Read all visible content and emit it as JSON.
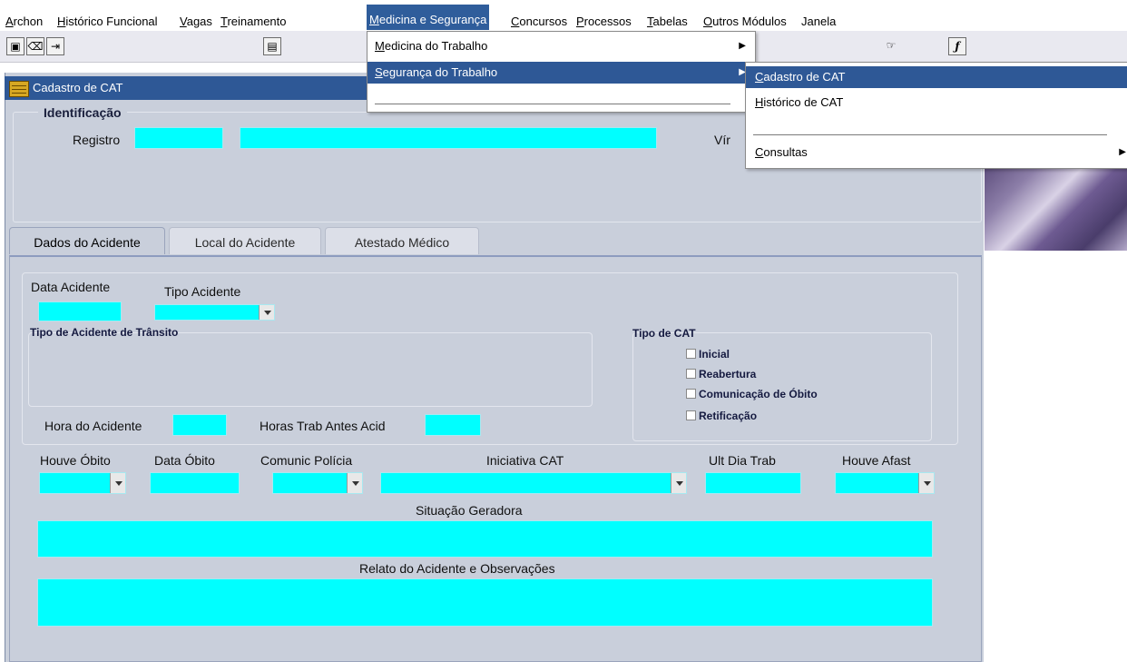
{
  "menubar": {
    "items": [
      {
        "pre": "",
        "u": "A",
        "post": "rchon"
      },
      {
        "pre": "",
        "u": "H",
        "post": "istórico Funcional"
      },
      {
        "pre": "",
        "u": "V",
        "post": "agas"
      },
      {
        "pre": "",
        "u": "T",
        "post": "reinamento"
      },
      {
        "pre": "",
        "u": "M",
        "post": "edicina e Segurança"
      },
      {
        "pre": "",
        "u": "C",
        "post": "oncursos"
      },
      {
        "pre": "",
        "u": "P",
        "post": "rocessos"
      },
      {
        "pre": "",
        "u": "T",
        "post": "abelas"
      },
      {
        "pre": "",
        "u": "O",
        "post": "utros Módulos"
      },
      {
        "pre": "Janela",
        "u": "",
        "post": ""
      }
    ]
  },
  "window": {
    "title": "Cadastro de CAT"
  },
  "identificacao": {
    "legend": "Identificação",
    "registro_label": "Registro",
    "vinculo_label": "Vír"
  },
  "tabs": [
    "Dados do Acidente",
    "Local do Acidente",
    "Atestado Médico"
  ],
  "form": {
    "data_acidente": "Data Acidente",
    "tipo_acidente": "Tipo Acidente",
    "tipo_transito": "Tipo de Acidente de Trânsito",
    "tipo_cat": "Tipo de CAT",
    "cat_options": [
      "Inicial",
      "Reabertura",
      "Comunicação de Óbito",
      "Retificação"
    ],
    "hora_acidente": "Hora do Acidente",
    "horas_trab": "Horas Trab Antes Acid",
    "houve_obito": "Houve Óbito",
    "data_obito": "Data Óbito",
    "comunic_policia": "Comunic Polícia",
    "iniciativa_cat": "Iniciativa CAT",
    "ult_dia_trab": "Ult Dia Trab",
    "houve_afast": "Houve Afast",
    "situacao_geradora": "Situação Geradora",
    "relato": "Relato do Acidente e Observações"
  },
  "menu_medicina": {
    "items": [
      {
        "u": "M",
        "rest": "edicina do Trabalho"
      },
      {
        "u": "S",
        "rest": "egurança do Trabalho"
      }
    ]
  },
  "menu_seguranca": {
    "items": [
      {
        "u": "C",
        "rest": "adastro de CAT"
      },
      {
        "u": "H",
        "rest": "istórico de CAT"
      },
      {
        "u": "C",
        "rest": "onsultas"
      }
    ]
  }
}
